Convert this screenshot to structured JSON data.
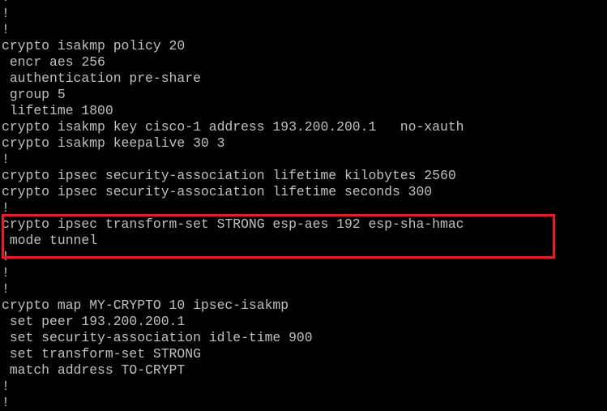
{
  "terminal": {
    "lines": [
      "!",
      "!",
      "!",
      "crypto isakmp policy 20",
      " encr aes 256",
      " authentication pre-share",
      " group 5",
      " lifetime 1800",
      "crypto isakmp key cisco-1 address 193.200.200.1   no-xauth",
      "crypto isakmp keepalive 30 3",
      "!",
      "crypto ipsec security-association lifetime kilobytes 2560",
      "crypto ipsec security-association lifetime seconds 300",
      "!",
      "crypto ipsec transform-set STRONG esp-aes 192 esp-sha-hmac",
      " mode tunnel",
      "!",
      "!",
      "!",
      "crypto map MY-CRYPTO 10 ipsec-isakmp",
      " set peer 193.200.200.1",
      " set security-association idle-time 900",
      " set transform-set STRONG",
      " match address TO-CRYPT",
      "!",
      "!"
    ]
  },
  "colors": {
    "background": "#000000",
    "text": "#c0c0c0",
    "highlight": "#e81c24"
  }
}
